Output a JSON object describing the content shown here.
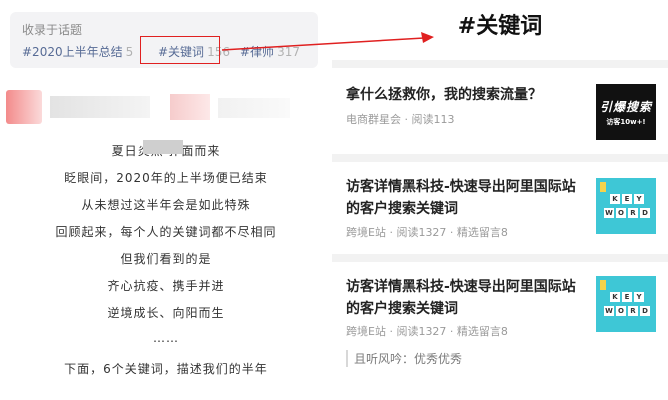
{
  "left": {
    "topic_label": "收录于话题",
    "tags": [
      {
        "name": "#2020上半年总结",
        "count": "5"
      },
      {
        "name": "#关键词",
        "count": "156"
      },
      {
        "name": "#律师",
        "count": "317"
      }
    ],
    "poem_lines": [
      "夏日炎热 扑面而来",
      "眨眼间，2020年的上半场便已结束",
      "从未想过这半年会是如此特殊",
      "回顾起来，每个人的关键词都不尽相同",
      "但我们看到的是",
      "齐心抗疫、携手并进",
      "逆境成长、向阳而生",
      "……",
      "下面，6个关键词，描述我们的半年"
    ]
  },
  "right": {
    "title": "#关键词",
    "articles": [
      {
        "title": "拿什么拯救你，我的搜索流量？",
        "meta": "电商群星会 · 阅读113",
        "thumb_line1": "引爆搜索",
        "thumb_line2": "访客10w+!"
      },
      {
        "title": "访客详情黑科技-快速导出阿里国际站的客户搜索关键词",
        "meta": "跨境E站 · 阅读1327 · 精选留言8",
        "thumb_keys": [
          "K",
          "E",
          "Y",
          "W",
          "O",
          "R",
          "D"
        ]
      },
      {
        "title": "访客详情黑科技-快速导出阿里国际站的客户搜索关键词",
        "meta": "跨境E站 · 阅读1327 · 精选留言8",
        "thumb_keys": [
          "K",
          "E",
          "Y",
          "W",
          "O",
          "R",
          "D"
        ],
        "quote": "且听风吟：优秀优秀"
      }
    ]
  },
  "colors": {
    "tag_blue": "#576b95",
    "highlight_red": "#e02020",
    "keyword_thumb_bg": "#3ec7d6"
  }
}
